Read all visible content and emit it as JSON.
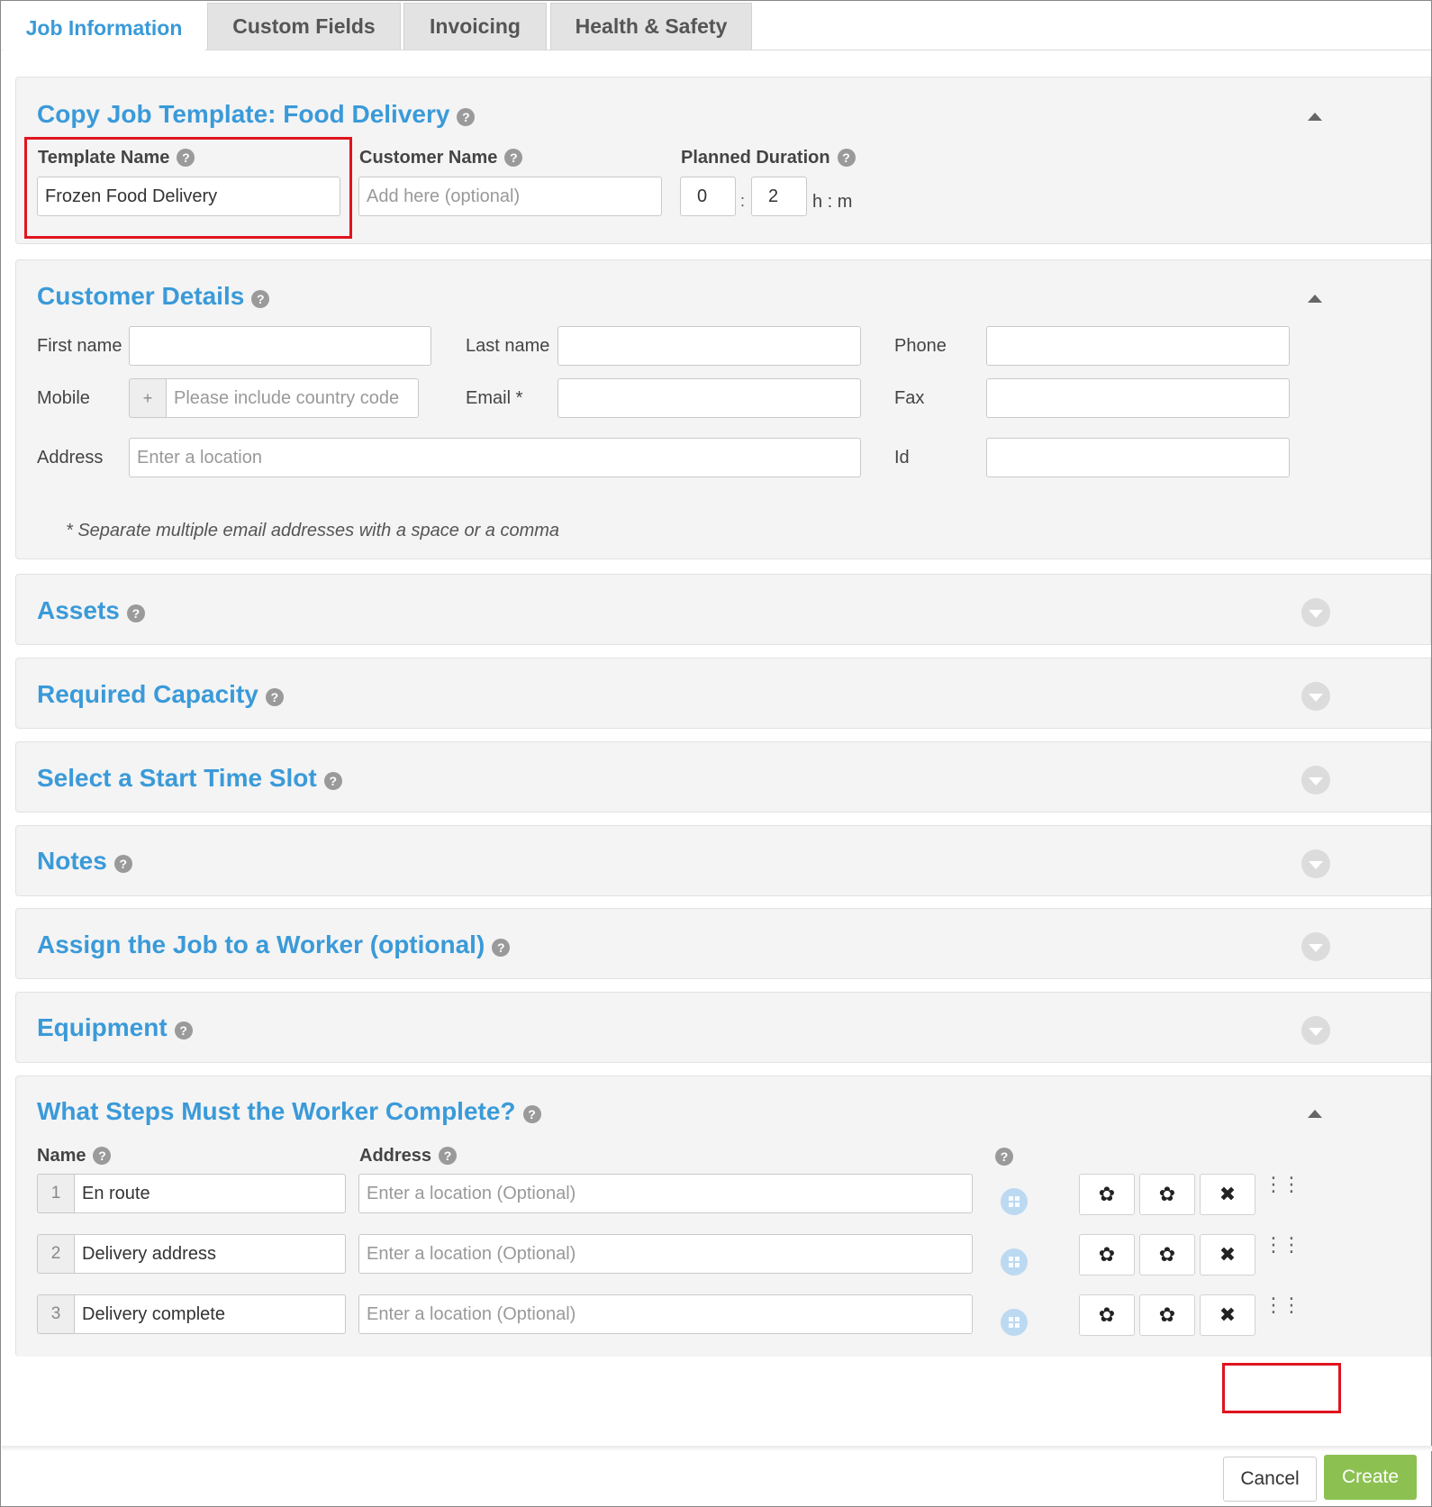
{
  "tabs": [
    {
      "label": "Job Information",
      "active": true
    },
    {
      "label": "Custom Fields",
      "active": false
    },
    {
      "label": "Invoicing",
      "active": false
    },
    {
      "label": "Health & Safety",
      "active": false
    }
  ],
  "copy_template": {
    "title": "Copy Job Template: Food Delivery",
    "template_name_label": "Template Name",
    "template_name_value": "Frozen Food Delivery",
    "customer_name_label": "Customer Name",
    "customer_name_placeholder": "Add here (optional)",
    "planned_duration_label": "Planned Duration",
    "duration_hours": "0",
    "duration_sep": ":",
    "duration_minutes": "2",
    "duration_unit": "h : m"
  },
  "customer_details": {
    "title": "Customer Details",
    "first_name_label": "First name",
    "last_name_label": "Last name",
    "phone_label": "Phone",
    "mobile_label": "Mobile",
    "mobile_prefix": "+",
    "mobile_placeholder": "Please include country code",
    "email_label": "Email *",
    "fax_label": "Fax",
    "address_label": "Address",
    "address_placeholder": "Enter a location",
    "id_label": "Id",
    "email_note": "* Separate multiple email addresses with a space or a comma"
  },
  "collapsed_sections": [
    {
      "title": "Assets"
    },
    {
      "title": "Required Capacity"
    },
    {
      "title": "Select a Start Time Slot"
    },
    {
      "title": "Notes"
    },
    {
      "title": "Assign the Job to a Worker (optional)"
    },
    {
      "title": "Equipment"
    }
  ],
  "steps": {
    "title": "What Steps Must the Worker Complete?",
    "name_header": "Name",
    "address_header": "Address",
    "address_placeholder": "Enter a location (Optional)",
    "rows": [
      {
        "number": "1",
        "name": "En route"
      },
      {
        "number": "2",
        "name": "Delivery address"
      },
      {
        "number": "3",
        "name": "Delivery complete"
      }
    ]
  },
  "icons": {
    "help": "?",
    "settings": "✿",
    "remove": "✖",
    "drag": "⋮⋮"
  },
  "footer": {
    "cancel_label": "Cancel",
    "create_label": "Create"
  },
  "colors": {
    "accent": "#3a9ad9",
    "create_button": "#8cc152",
    "highlight": "#e0141e"
  }
}
